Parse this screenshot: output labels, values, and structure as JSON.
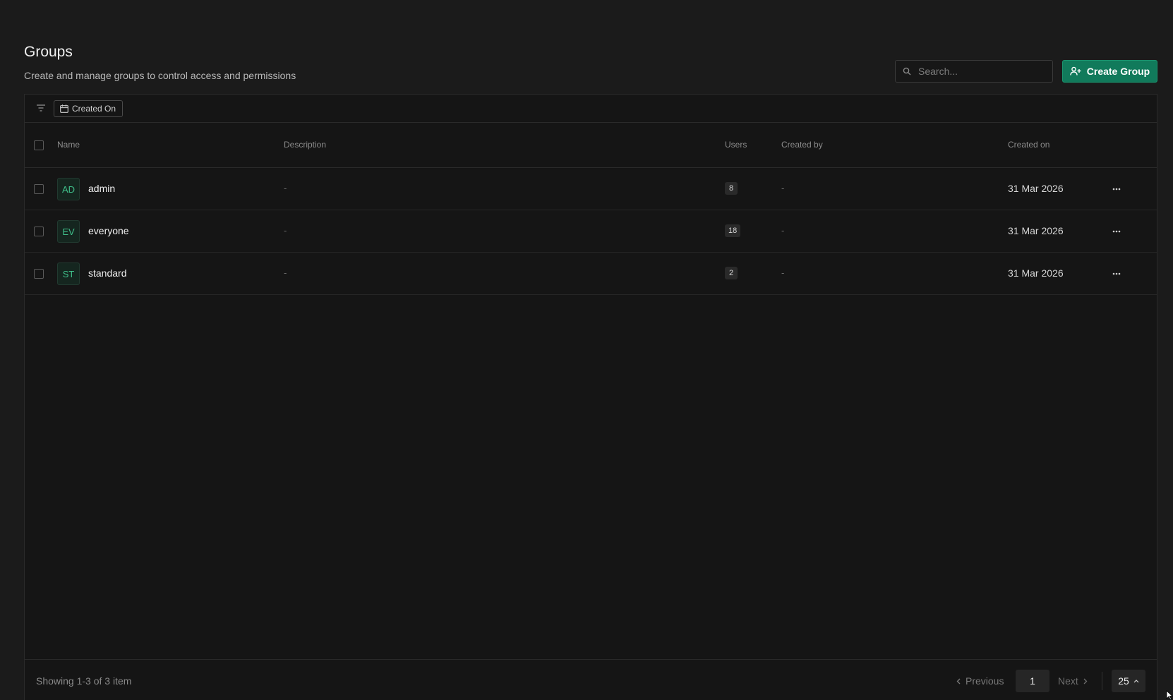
{
  "header": {
    "title": "Groups",
    "subtitle": "Create and manage groups to control access and permissions"
  },
  "search": {
    "placeholder": "Search..."
  },
  "actions": {
    "create_label": "Create Group"
  },
  "filters": {
    "chip_label": "Created On"
  },
  "table": {
    "columns": {
      "name": "Name",
      "description": "Description",
      "users": "Users",
      "created_by": "Created by",
      "created_on": "Created on"
    },
    "rows": [
      {
        "initials": "AD",
        "name": "admin",
        "description": "-",
        "users": "8",
        "created_by": "-",
        "created_on": "31 Mar 2026"
      },
      {
        "initials": "EV",
        "name": "everyone",
        "description": "-",
        "users": "18",
        "created_by": "-",
        "created_on": "31 Mar 2026"
      },
      {
        "initials": "ST",
        "name": "standard",
        "description": "-",
        "users": "2",
        "created_by": "-",
        "created_on": "31 Mar 2026"
      }
    ]
  },
  "pagination": {
    "summary": "Showing 1-3 of 3 item",
    "previous_label": "Previous",
    "current_page": "1",
    "next_label": "Next",
    "page_size": "25"
  },
  "colors": {
    "background": "#1b1b1b",
    "accent": "#117a5b",
    "avatar_text": "#3fbf8a"
  },
  "icons": [
    "search-icon",
    "add-users-icon",
    "filter-icon",
    "calendar-icon",
    "more-icon",
    "chevron-left-icon",
    "chevron-right-icon",
    "chevron-up-icon",
    "cursor-icon"
  ]
}
